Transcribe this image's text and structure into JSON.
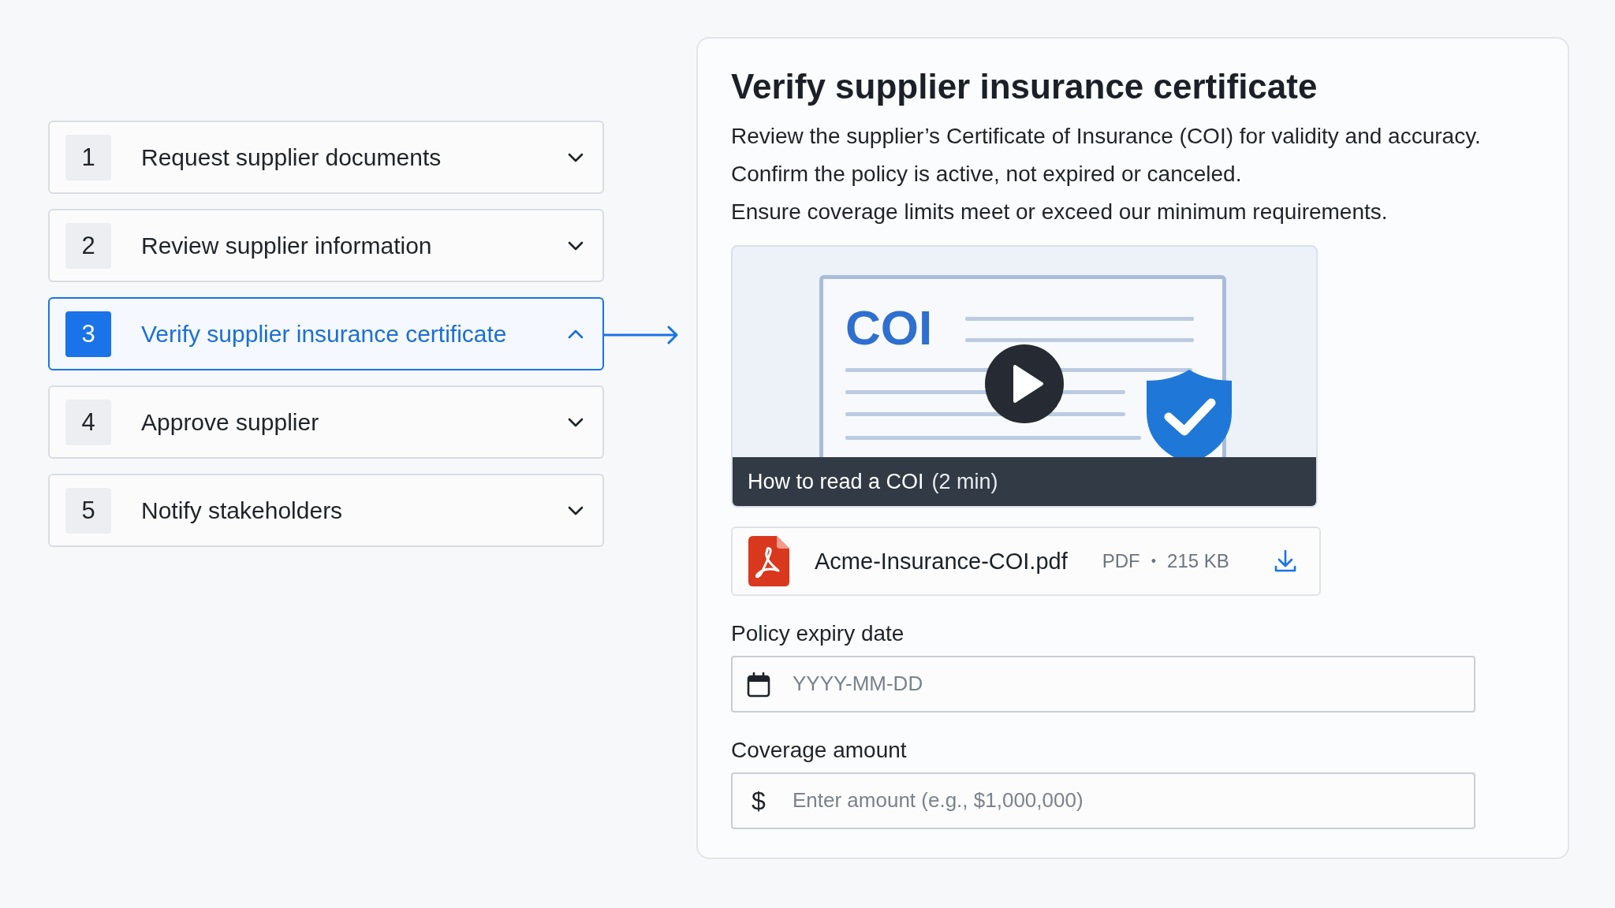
{
  "steps": [
    {
      "number": "1",
      "title": "Request supplier documents",
      "selected": false,
      "expanded": false
    },
    {
      "number": "2",
      "title": "Review supplier information",
      "selected": false,
      "expanded": false
    },
    {
      "number": "3",
      "title": "Verify supplier insurance certificate",
      "selected": true,
      "expanded": true
    },
    {
      "number": "4",
      "title": "Approve supplier",
      "selected": false,
      "expanded": false
    },
    {
      "number": "5",
      "title": "Notify stakeholders",
      "selected": false,
      "expanded": false
    }
  ],
  "detail": {
    "title": "Verify supplier insurance certificate",
    "paragraphs": [
      "Review the supplier’s Certificate of Insurance (COI) for validity and accuracy.",
      "Confirm the policy is active, not expired or canceled.",
      "Ensure coverage limits meet or exceed our minimum requirements."
    ],
    "video": {
      "thumbnail_title": "COI",
      "caption": "How to read a COI",
      "duration": "(2 min)"
    },
    "file": {
      "name": "Acme-Insurance-COI.pdf",
      "type": "PDF",
      "separator": "•",
      "size": "215 KB"
    },
    "fields": [
      {
        "label": "Policy expiry date",
        "kind": "date",
        "placeholder": "YYYY-MM-DD"
      },
      {
        "label": "Coverage amount",
        "kind": "currency",
        "prefix": "$",
        "placeholder": "Enter amount (e.g., $1,000,000)"
      }
    ]
  }
}
